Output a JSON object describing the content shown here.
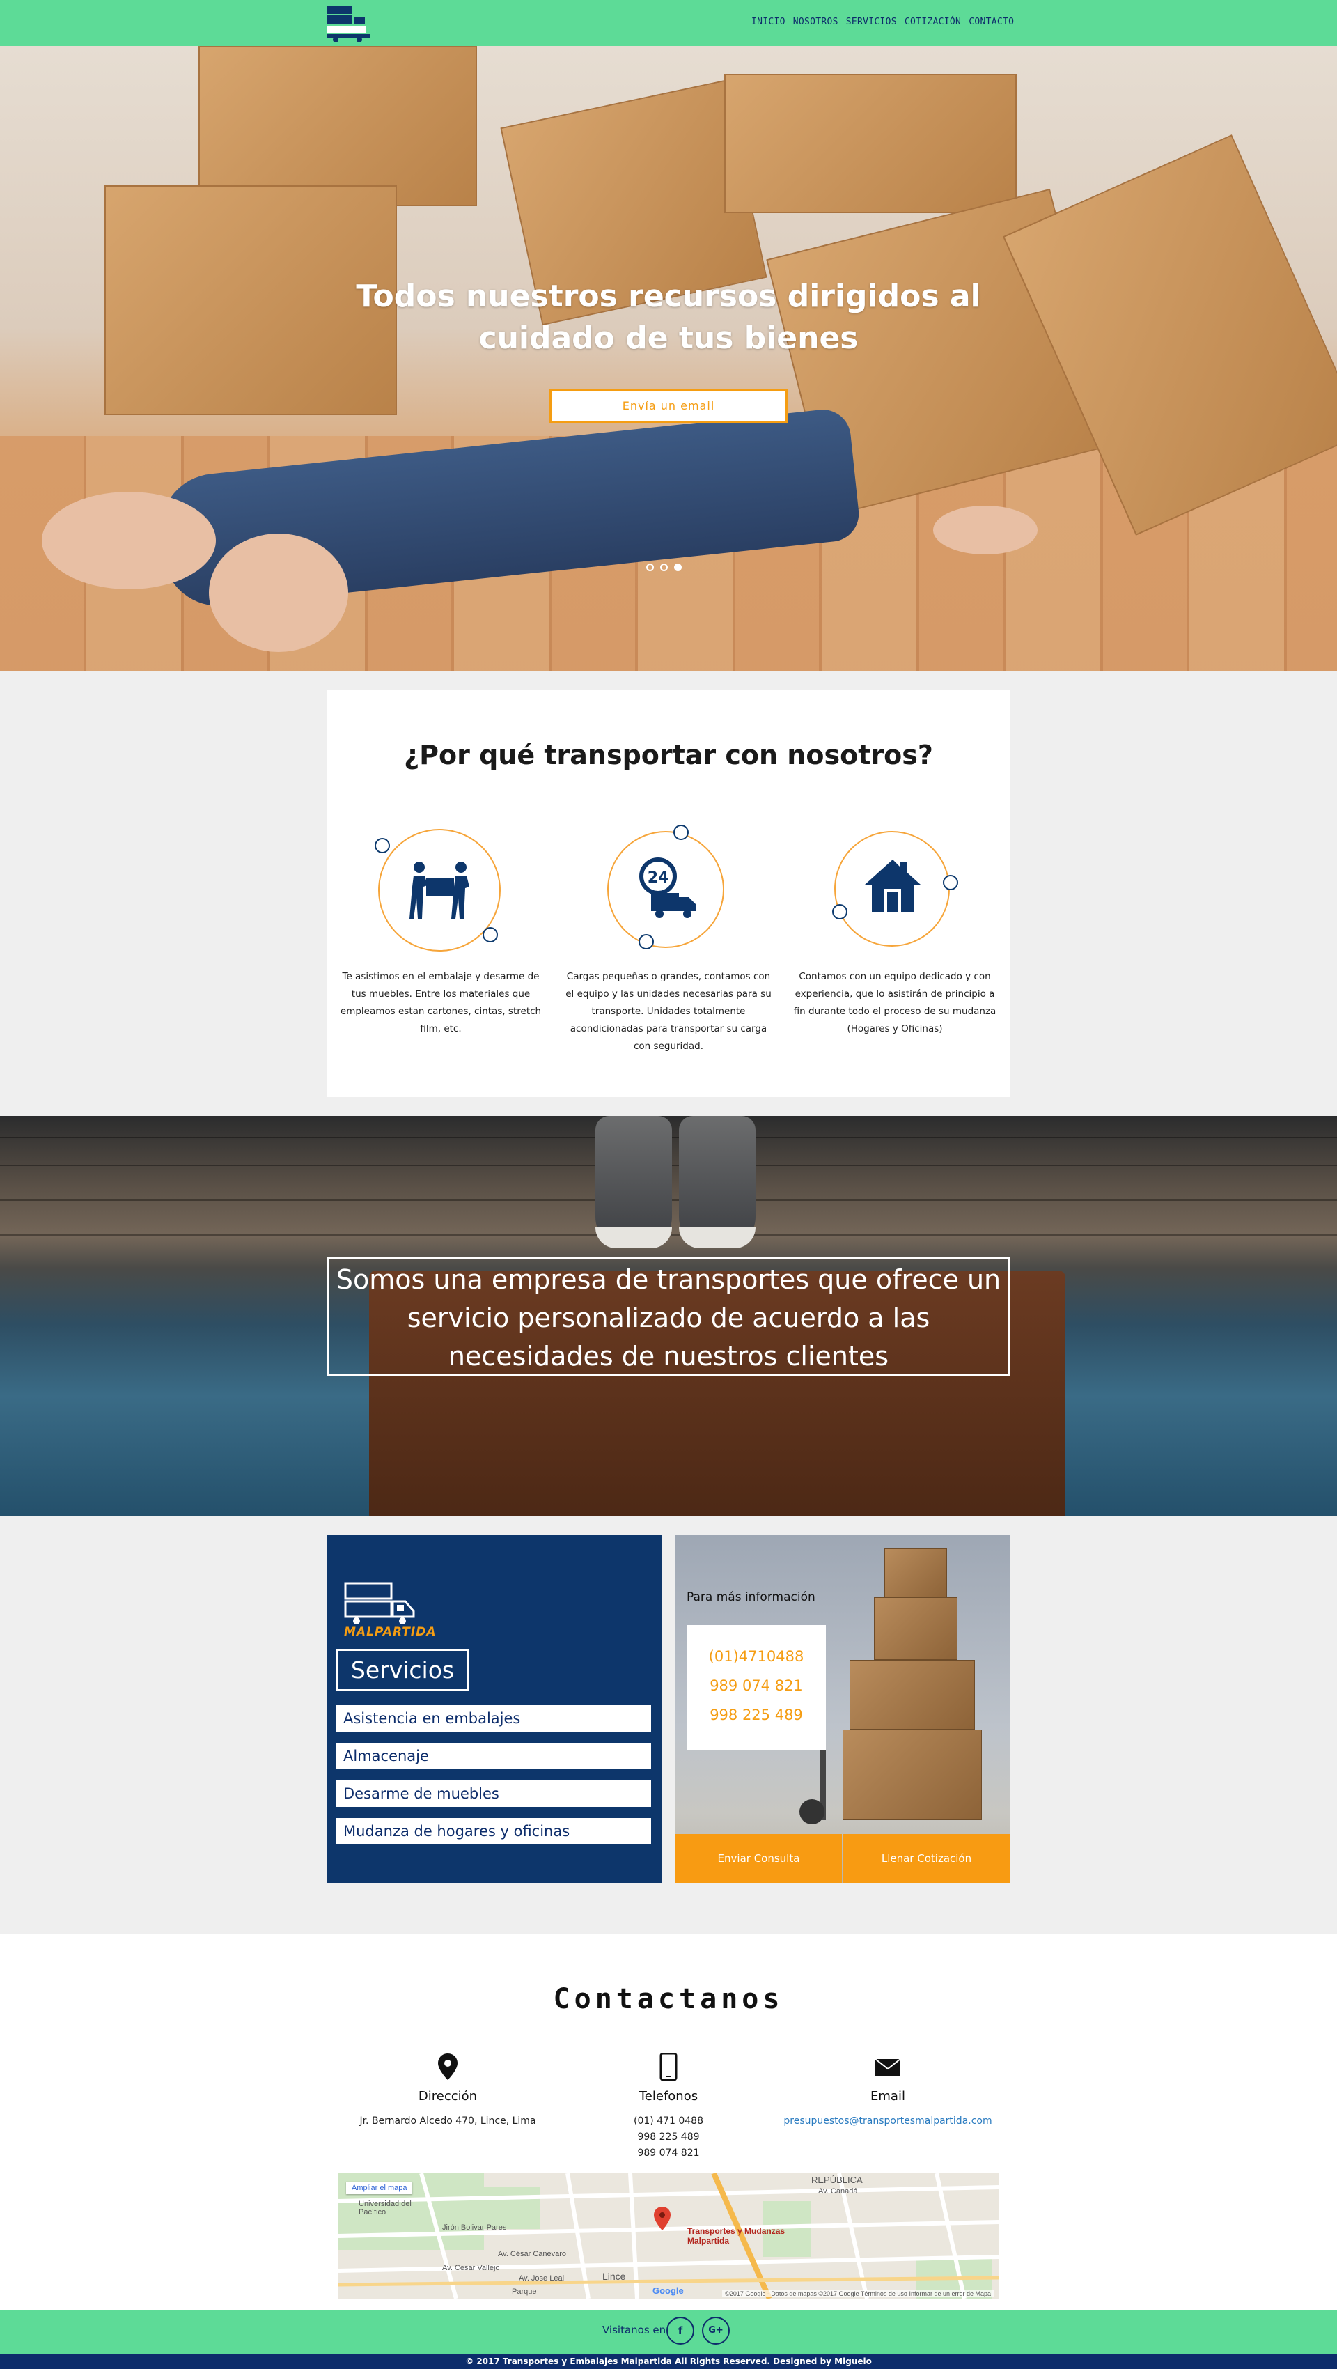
{
  "colors": {
    "nav_green": "#5ddb97",
    "navy": "#0d366b",
    "accent_orange": "#f59d12"
  },
  "nav": {
    "logo_icon": "truck-logo-icon",
    "items": [
      "INICIO",
      "NOSOTROS",
      "SERVICIOS",
      "COTIZACIÓN",
      "CONTACTO"
    ]
  },
  "hero": {
    "title": "Todos nuestros recursos dirigidos al cuidado de tus bienes",
    "button": "Envía un email",
    "slides": 3,
    "active_slide": 3
  },
  "why": {
    "title": "¿Por qué transportar con nosotros?",
    "features": [
      {
        "icon": "movers-carrying-box-icon",
        "text": "Te asistimos en el embalaje y desarme de tus muebles. Entre los materiales que empleamos estan cartones, cintas, stretch film, etc."
      },
      {
        "icon": "24h-delivery-truck-icon",
        "text": "Cargas pequeñas o grandes, contamos con el equipo y las unidades necesarias para su transporte. Unidades totalmente acondicionadas para transportar su carga con seguridad."
      },
      {
        "icon": "house-icon",
        "text": "Contamos con un equipo dedicado y con experiencia, que lo asistirán de principio a fin durante todo el proceso de su mudanza (Hogares y Oficinas)"
      }
    ]
  },
  "banner": {
    "text": "Somos una empresa de transportes que ofrece un servicio personalizado de acuerdo a las necesidades de nuestros clientes"
  },
  "services": {
    "logo_text": "MALPARTIDA",
    "title": "Servicios",
    "items": [
      "Asistencia en embalajes",
      "Almacenaje",
      "Desarme de muebles",
      "Mudanza de hogares y oficinas"
    ]
  },
  "info": {
    "title": "Para más información",
    "phones": [
      "(01)4710488",
      "989 074 821",
      "998 225 489"
    ],
    "buttons": [
      "Enviar Consulta",
      "Llenar Cotización"
    ]
  },
  "contact": {
    "title": "Contactanos",
    "columns": [
      {
        "icon": "map-pin-icon",
        "label": "Dirección",
        "value": "Jr. Bernardo Alcedo 470, Lince, Lima"
      },
      {
        "icon": "mobile-phone-icon",
        "label": "Telefonos",
        "values": [
          "(01) 471 0488",
          "998 225 489",
          "989 074 821"
        ]
      },
      {
        "icon": "envelope-icon",
        "label": "Email",
        "value": "presupuestos@transportesmalpartida.com"
      }
    ],
    "map": {
      "expand_link": "Ampliar el mapa",
      "place_label": "Transportes y Mudanzas Malpartida",
      "labels": [
        "Universidad del Pacífico",
        "Jirón Bolivar Pares",
        "Av. César Canevaro",
        "Av. Cesar Vallejo",
        "Av. Jose Leal",
        "Parque",
        "Lince",
        "REPÚBLICA",
        "Av. Canadá"
      ],
      "google": "Google",
      "footer": "©2017 Google - Datos de mapas ©2017 Google   Términos de uso   Informar de un error de Mapa"
    }
  },
  "footer": {
    "follow": "Visitanos en",
    "social": [
      "f",
      "G+"
    ],
    "copyright": "© 2017 Transportes y Embalajes Malpartida All Rights Reserved. Designed by Miguelo"
  }
}
